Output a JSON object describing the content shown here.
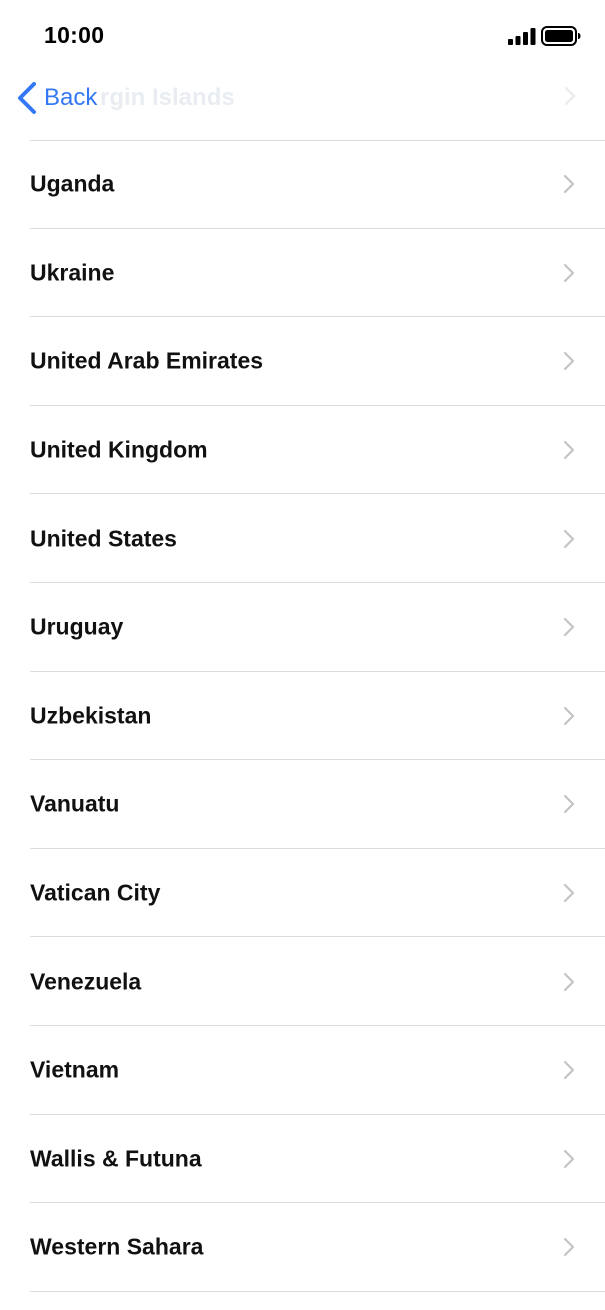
{
  "status_bar": {
    "time": "10:00",
    "signal_icon": "cellular-signal-icon",
    "battery_icon": "battery-full-icon"
  },
  "nav": {
    "back_label": "Back",
    "ghost_title": "rgin Islands",
    "back_icon": "chevron-left-icon"
  },
  "colors": {
    "accent": "#3478f6",
    "separator": "#dcdcdf",
    "chevron": "#c4c4c7",
    "text": "#111111"
  },
  "countries": [
    {
      "label": "Uganda"
    },
    {
      "label": "Ukraine"
    },
    {
      "label": "United Arab Emirates"
    },
    {
      "label": "United Kingdom"
    },
    {
      "label": "United States"
    },
    {
      "label": "Uruguay"
    },
    {
      "label": "Uzbekistan"
    },
    {
      "label": "Vanuatu"
    },
    {
      "label": "Vatican City"
    },
    {
      "label": "Venezuela"
    },
    {
      "label": "Vietnam"
    },
    {
      "label": "Wallis & Futuna"
    },
    {
      "label": "Western Sahara"
    }
  ]
}
